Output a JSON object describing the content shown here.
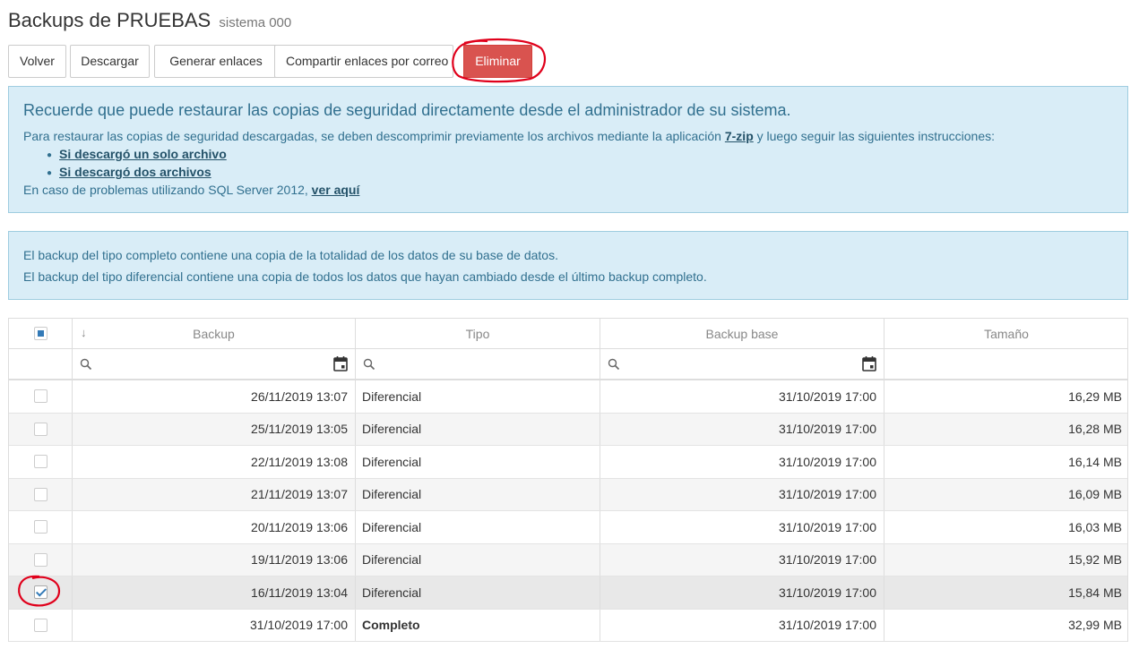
{
  "page": {
    "title": "Backups de PRUEBAS",
    "subtitle": "sistema 000"
  },
  "toolbar": {
    "buttons": [
      {
        "label": "Volver"
      },
      {
        "label": "Descargar"
      },
      {
        "label": "Generar enlaces"
      },
      {
        "label": "Compartir enlaces por correo"
      },
      {
        "label": "Eliminar"
      }
    ]
  },
  "info": {
    "heading": "Recuerde que puede restaurar las copias de seguridad directamente desde el administrador de su sistema.",
    "text_before_link": "Para restaurar las copias de seguridad descargadas, se deben descomprimir previamente los archivos mediante la aplicación ",
    "zip_link": "7-zip",
    "text_after_link": " y luego seguir las siguientes instrucciones:",
    "links": [
      "Si descargó un solo archivo",
      "Si descargó dos archivos"
    ],
    "problems_text": "En caso de problemas utilizando SQL Server 2012, ",
    "problems_link": "ver aquí"
  },
  "notes": {
    "line1": "El backup del tipo completo contiene una copia de la totalidad de los datos de su base de datos.",
    "line2": "El backup del tipo diferencial contiene una copia de todos los datos que hayan cambiado desde el último backup completo."
  },
  "colors": {
    "danger": "#d9534f",
    "info_bg": "#d9edf7",
    "info_text": "#31708f",
    "annotation": "#e0001b"
  },
  "grid": {
    "sort_icon": "sort-down-arrow-icon",
    "columns": [
      "Backup",
      "Tipo",
      "Backup base",
      "Tamaño"
    ],
    "rows": [
      {
        "backup": "26/11/2019 13:07",
        "tipo": "Diferencial",
        "base": "31/10/2019 17:00",
        "size": "16,29 MB",
        "checked": false
      },
      {
        "backup": "25/11/2019 13:05",
        "tipo": "Diferencial",
        "base": "31/10/2019 17:00",
        "size": "16,28 MB",
        "checked": false
      },
      {
        "backup": "22/11/2019 13:08",
        "tipo": "Diferencial",
        "base": "31/10/2019 17:00",
        "size": "16,14 MB",
        "checked": false
      },
      {
        "backup": "21/11/2019 13:07",
        "tipo": "Diferencial",
        "base": "31/10/2019 17:00",
        "size": "16,09 MB",
        "checked": false
      },
      {
        "backup": "20/11/2019 13:06",
        "tipo": "Diferencial",
        "base": "31/10/2019 17:00",
        "size": "16,03 MB",
        "checked": false
      },
      {
        "backup": "19/11/2019 13:06",
        "tipo": "Diferencial",
        "base": "31/10/2019 17:00",
        "size": "15,92 MB",
        "checked": false
      },
      {
        "backup": "16/11/2019 13:04",
        "tipo": "Diferencial",
        "base": "31/10/2019 17:00",
        "size": "15,84 MB",
        "checked": true
      },
      {
        "backup": "31/10/2019 17:00",
        "tipo": "Completo",
        "base": "31/10/2019 17:00",
        "size": "32,99 MB",
        "checked": false
      }
    ]
  }
}
